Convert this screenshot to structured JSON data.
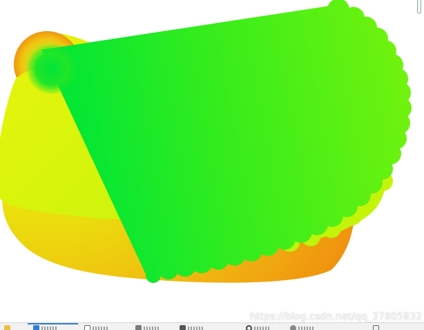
{
  "watermark": {
    "text": "https://blog.csdn.net/qq_37805832"
  },
  "colors": {
    "orange": "#f0930f",
    "yellow": "#e6f00a",
    "lime": "#b8f40a",
    "green_bright": "#00e632",
    "green_light": "#6cf20f",
    "taskbar_bg": "#f2f2f2",
    "taskbar_active": "#2f7fd6"
  },
  "taskbar": {
    "tasks": [
      {
        "icon": "folder-icon"
      },
      {
        "icon": "browser-icon"
      },
      {
        "icon": "document-icon"
      },
      {
        "icon": "chart-icon"
      },
      {
        "icon": "tool-icon"
      },
      {
        "icon": "search-icon"
      },
      {
        "icon": "settings-icon"
      },
      {
        "icon": "app-icon"
      }
    ]
  }
}
